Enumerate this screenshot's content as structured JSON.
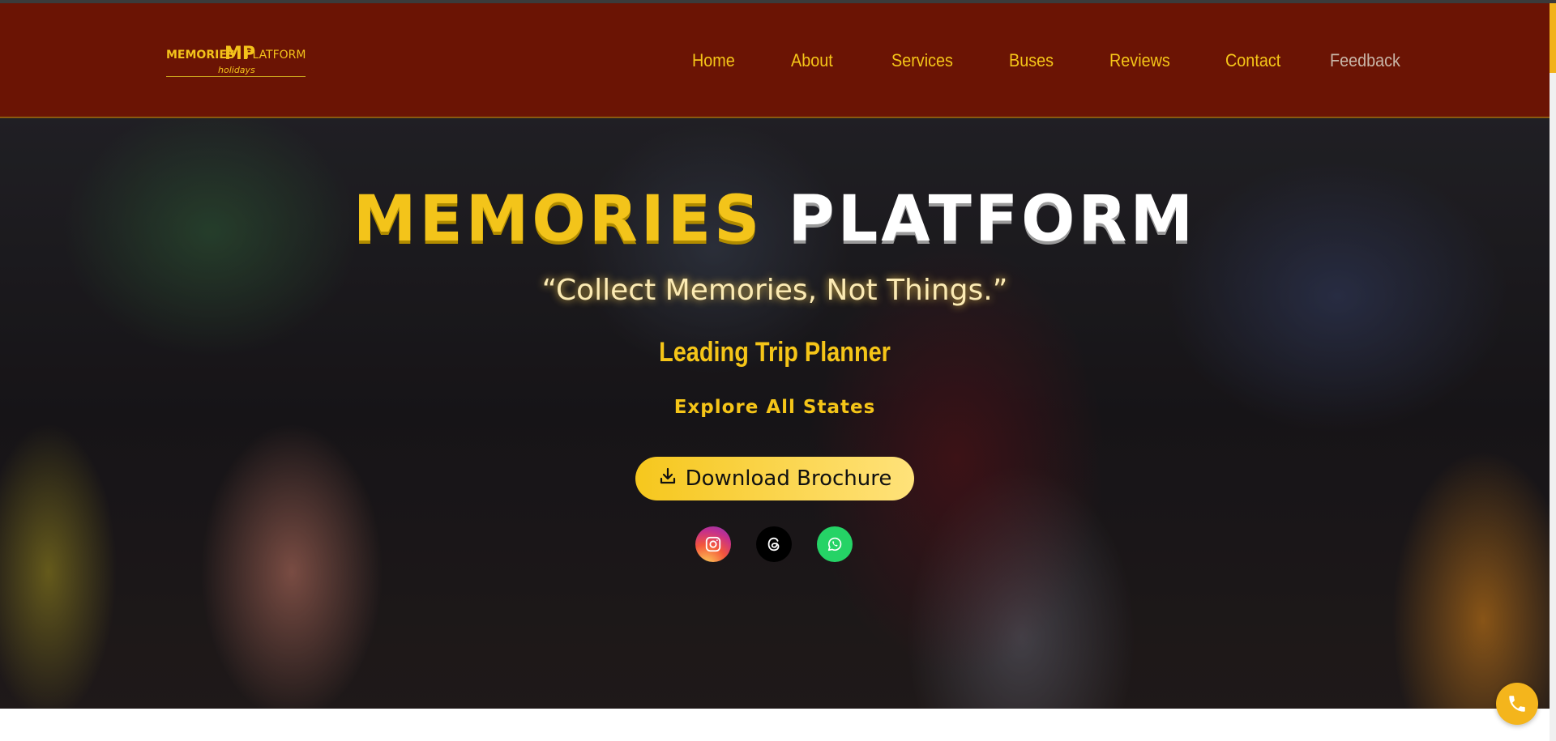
{
  "brand": {
    "logo_text_left": "MEMORIES",
    "logo_mark": "MP",
    "logo_text_right": "PLATFORM",
    "logo_subtext": "holidays"
  },
  "nav": {
    "items": [
      {
        "label": "Home"
      },
      {
        "label": "About"
      },
      {
        "label": "Services"
      },
      {
        "label": "Buses"
      },
      {
        "label": "Reviews"
      },
      {
        "label": "Contact"
      },
      {
        "label": "Feedback"
      }
    ]
  },
  "hero": {
    "title_word1": "MEMORIES",
    "title_word2": "PLATFORM",
    "tagline": "“Collect Memories, Not Things.”",
    "subtitle": "Leading Trip Planner",
    "explore": "Explore All States",
    "cta_label": "Download Brochure"
  },
  "social": {
    "icons": [
      "instagram-icon",
      "threads-icon",
      "whatsapp-icon"
    ]
  },
  "floating": {
    "call_icon": "phone-icon"
  },
  "colors": {
    "navbar_bg": "#6b1404",
    "accent_yellow": "#f5c518",
    "cta_bg": "#f6c71d",
    "whatsapp": "#25d366",
    "call_button": "#f4b51c"
  }
}
